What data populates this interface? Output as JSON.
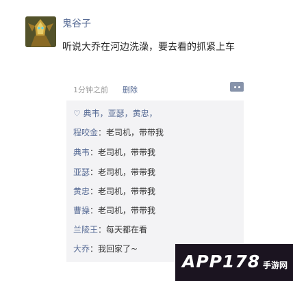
{
  "post": {
    "author": "鬼谷子",
    "text": "听说大乔在河边洗澡，要去看的抓紧上车",
    "time": "1分钟之前",
    "delete_label": "删除"
  },
  "likes": "♡ 典韦，亚瑟，黄忠，",
  "comments": [
    {
      "name": "程咬金",
      "sep": "：",
      "text": "老司机，带带我"
    },
    {
      "name": "典韦",
      "sep": "：",
      "text": "老司机，带带我"
    },
    {
      "name": "亚瑟",
      "sep": "：",
      "text": "老司机，带带我"
    },
    {
      "name": "黄忠",
      "sep": "：",
      "text": "老司机，带带我"
    },
    {
      "name": "曹操",
      "sep": "：",
      "text": "老司机，带带我"
    },
    {
      "name": "兰陵王",
      "sep": "：",
      "text": "每天都在看"
    },
    {
      "name": "大乔",
      "sep": "：",
      "text": "我回家了~"
    }
  ],
  "watermark": {
    "brand": "APP178",
    "sub": "手游网"
  },
  "colors": {
    "link": "#576b95",
    "comment_bg": "#f3f3f5"
  }
}
